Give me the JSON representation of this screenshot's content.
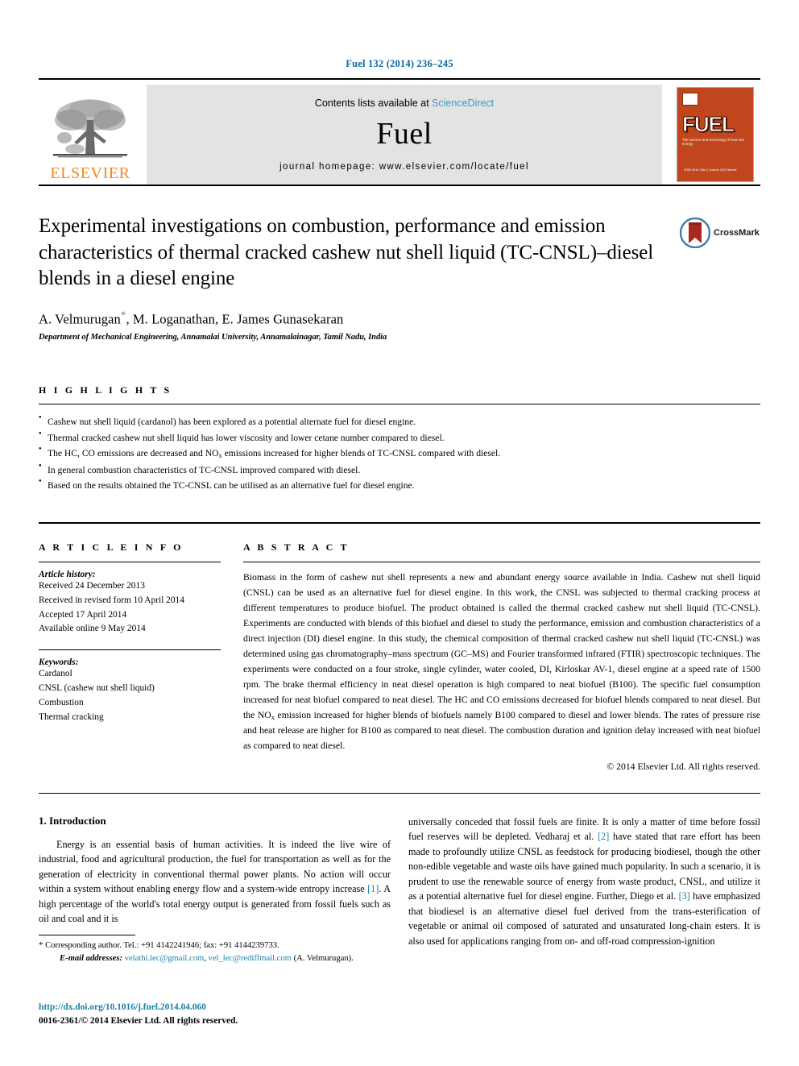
{
  "running_head": "Fuel 132 (2014) 236–245",
  "masthead": {
    "elsevier_wordmark": "ELSEVIER",
    "contents_prefix": "Contents lists available at ",
    "contents_link": "ScienceDirect",
    "journal_name": "Fuel",
    "homepage": "journal homepage: www.elsevier.com/locate/fuel",
    "cover_title": "FUEL",
    "cover_subtitle": "The science and technology of fuel and energy",
    "cover_footer": "ISSN 0016-2361 | Volume 132\nElsevier"
  },
  "title": "Experimental investigations on combustion, performance and emission characteristics of thermal cracked cashew nut shell liquid (TC-CNSL)–diesel blends in a diesel engine",
  "crossmark_label": "CrossMark",
  "authors": {
    "name_1": "A. Velmurugan",
    "star": "*",
    "rest": ", M. Loganathan, E. James Gunasekaran"
  },
  "affiliation": "Department of Mechanical Engineering, Annamalai University, Annamalainagar, Tamil Nadu, India",
  "highlights": {
    "heading": "H I G H L I G H T S",
    "items": [
      "Cashew nut shell liquid (cardanol) has been explored as a potential alternate fuel for diesel engine.",
      "Thermal cracked cashew nut shell liquid has lower viscosity and lower cetane number compared to diesel.",
      "In general combustion characteristics of TC-CNSL improved compared with diesel.",
      "Based on the results obtained the TC-CNSL can be utilised as an alternative fuel for diesel engine."
    ],
    "item_nox_a": "The HC, CO emissions are decreased and NO",
    "item_nox_sub": "x",
    "item_nox_b": " emissions increased for higher blends of TC-CNSL compared with diesel."
  },
  "article_info": {
    "heading": "A R T I C L E  I N F O",
    "history_label": "Article history:",
    "history": [
      "Received 24 December 2013",
      "Received in revised form 10 April 2014",
      "Accepted 17 April 2014",
      "Available online 9 May 2014"
    ],
    "keywords_label": "Keywords:",
    "keywords": [
      "Cardanol",
      "CNSL (cashew nut shell liquid)",
      "Combustion",
      "Thermal cracking"
    ]
  },
  "abstract": {
    "heading": "A B S T R A C T",
    "part1": "Biomass in the form of cashew nut shell represents a new and abundant energy source available in India. Cashew nut shell liquid (CNSL) can be used as an alternative fuel for diesel engine. In this work, the CNSL was subjected to thermal cracking process at different temperatures to produce biofuel. The product obtained is called the thermal cracked cashew nut shell liquid (TC-CNSL). Experiments are conducted with blends of this biofuel and diesel to study the performance, emission and combustion characteristics of a direct injection (DI) diesel engine. In this study, the chemical composition of thermal cracked cashew nut shell liquid (TC-CNSL) was determined using gas chromatography–mass spectrum (GC–MS) and Fourier transformed infrared (FTIR) spectroscopic techniques. The experiments were conducted on a four stroke, single cylinder, water cooled, DI, Kirloskar AV-1, diesel engine at a speed rate of 1500 rpm. The brake thermal efficiency in neat diesel operation is high compared to neat biofuel (B100). The specific fuel consumption increased for neat biofuel compared to neat diesel. The HC and CO emissions decreased for biofuel blends compared to neat diesel. But the NO",
    "nox_sub": "x",
    "part2": " emission increased for higher blends of biofuels namely B100 compared to diesel and lower blends. The rates of pressure rise and heat release are higher for B100 as compared to neat diesel. The combustion duration and ignition delay increased with neat biofuel as compared to neat diesel.",
    "copyright": "© 2014 Elsevier Ltd. All rights reserved."
  },
  "body": {
    "section_heading": "1. Introduction",
    "left_p1_a": "Energy is an essential basis of human activities. It is indeed the live wire of industrial, food and agricultural production, the fuel for transportation as well as for the generation of electricity in conventional thermal power plants. No action will occur within a system without enabling energy flow and a system-wide entropy increase ",
    "left_ref1": "[1]",
    "left_p1_b": ". A high percentage of the world's total energy output is generated from fossil fuels such as oil and coal and it is",
    "right_p1_a": "universally conceded that fossil fuels are finite. It is only a matter of time before fossil fuel reserves will be depleted. Vedharaj et al. ",
    "right_ref2": "[2]",
    "right_p1_b": " have stated that rare effort has been made to profoundly utilize CNSL as feedstock for producing biodiesel, though the other non-edible vegetable and waste oils have gained much popularity. In such a scenario, it is prudent to use the renewable source of energy from waste product, CNSL, and utilize it as a potential alternative fuel for diesel engine. Further, Diego et al. ",
    "right_ref3": "[3]",
    "right_p1_c": " have emphasized that biodiesel is an alternative diesel fuel derived from the trans-esterification of vegetable or animal oil composed of saturated and unsaturated long-chain esters. It is also used for applications ranging from on- and off-road compression-ignition"
  },
  "footnote": {
    "star": "*",
    "corresponding": " Corresponding author. Tel.: +91 4142241946; fax: +91 4144239733.",
    "email_label": "E-mail addresses:",
    "email_1": "velathi.lec@gmail.com",
    "email_sep": ", ",
    "email_2": "vel_lec@rediffmail.com",
    "email_suffix": " (A. Velmurugan).",
    "doi": "http://dx.doi.org/10.1016/j.fuel.2014.04.060",
    "issn": "0016-2361/© 2014 Elsevier Ltd. All rights reserved."
  },
  "colors": {
    "link_blue": "#1a7fa8",
    "sciencedirect_blue": "#2f9fd0",
    "elsevier_orange": "#f08a1c",
    "cover_orange": "#c1461d"
  }
}
